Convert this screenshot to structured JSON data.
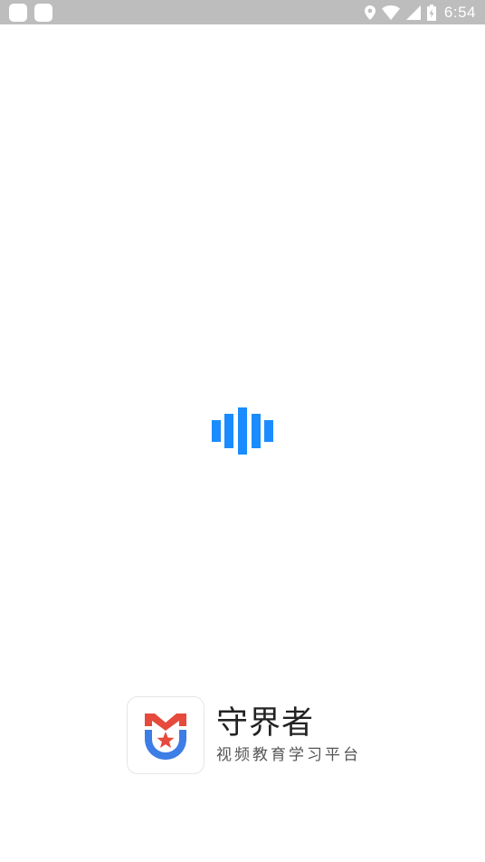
{
  "status_bar": {
    "time": "6:54",
    "icons": [
      "notification-square-icon",
      "notification-square-icon",
      "location-icon",
      "wifi-icon",
      "cell-signal-icon",
      "battery-charging-icon"
    ]
  },
  "loader": {
    "icon": "loading-bars-icon",
    "color": "#1a8cff"
  },
  "brand": {
    "logo_icon": "shield-star-logo",
    "name": "守界者",
    "tagline": "视频教育学习平台",
    "colors": {
      "logo_red": "#e64a3c",
      "logo_blue": "#3d7de6"
    }
  }
}
